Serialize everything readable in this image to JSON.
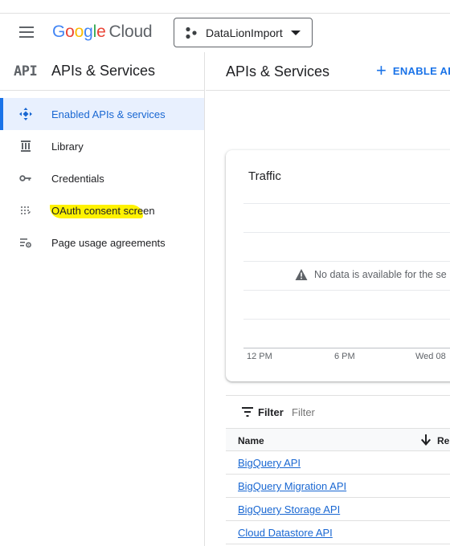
{
  "topbar": {
    "logo_letters": [
      "G",
      "o",
      "o",
      "g",
      "l",
      "e"
    ],
    "logo_product": "Cloud",
    "project_name": "DataLionImport"
  },
  "sidebar": {
    "logo": "API",
    "title": "APIs & Services",
    "items": [
      {
        "label": "Enabled APIs & services",
        "icon": "move-diamond-icon",
        "active": true
      },
      {
        "label": "Library",
        "icon": "library-icon",
        "active": false
      },
      {
        "label": "Credentials",
        "icon": "key-icon",
        "active": false
      },
      {
        "label": "OAuth consent screen",
        "icon": "dots-grid-icon",
        "active": false,
        "highlighted": true
      },
      {
        "label": "Page usage agreements",
        "icon": "settings-list-icon",
        "active": false
      }
    ]
  },
  "main": {
    "title": "APIs & Services",
    "enable_button": "ENABLE AP"
  },
  "traffic": {
    "title": "Traffic",
    "no_data": "No data is available for the se",
    "x_ticks": [
      "12 PM",
      "6 PM",
      "Wed 08"
    ]
  },
  "filter": {
    "label": "Filter",
    "placeholder": "Filter"
  },
  "table": {
    "columns": [
      "Name",
      "Re"
    ],
    "rows": [
      "BigQuery API",
      "BigQuery Migration API",
      "BigQuery Storage API",
      "Cloud Datastore API"
    ]
  },
  "colors": {
    "accent": "#1a73e8",
    "highlight": "#fff200",
    "active_bg": "#e8f0fe"
  }
}
